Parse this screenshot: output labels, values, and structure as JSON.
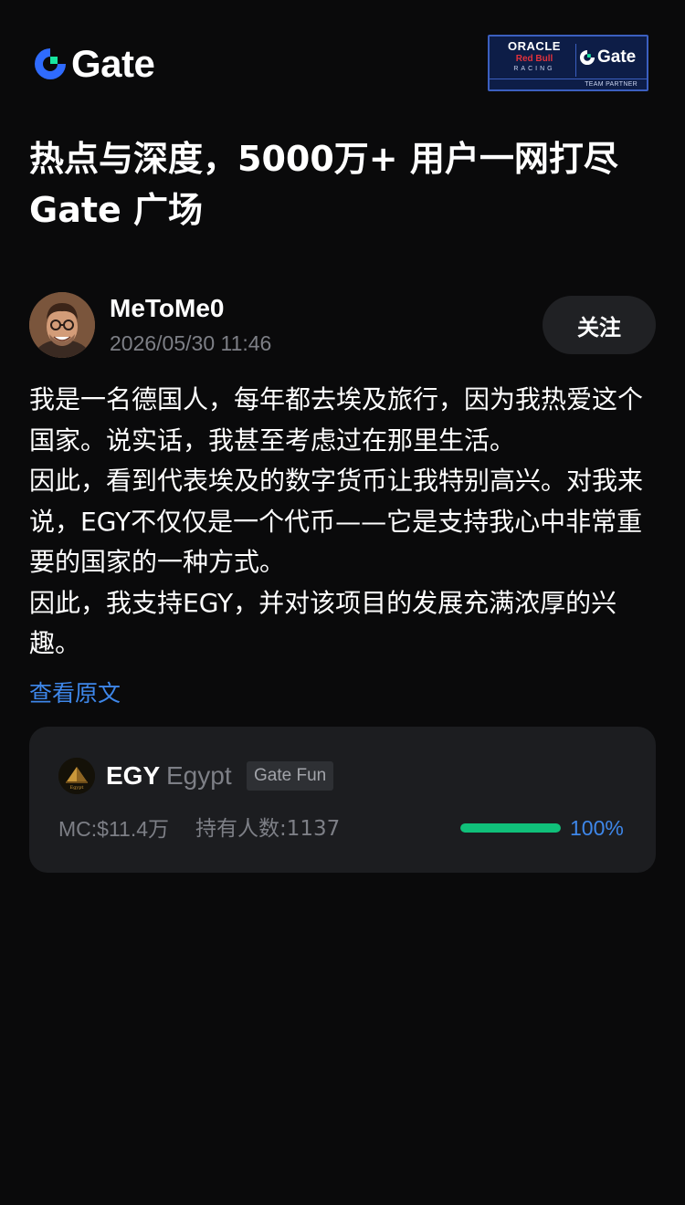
{
  "header": {
    "logo_text": "Gate",
    "partner": {
      "oracle": "ORACLE",
      "redbull": "Red Bull",
      "racing": "RACING",
      "gate": "Gate",
      "footer": "TEAM PARTNER"
    }
  },
  "headline": {
    "line1": "热点与深度，5000万+ 用户一网打尽",
    "line2": "Gate 广场"
  },
  "post": {
    "author": "MeToMe0",
    "time": "2026/05/30 11:46",
    "follow_label": "关注",
    "paragraphs": [
      "我是一名德国人，每年都去埃及旅行，因为我热爱这个国家。说实话，我甚至考虑过在那里生活。",
      "因此，看到代表埃及的数字货币让我特别高兴。对我来说，EGY不仅仅是一个代币——它是支持我心中非常重要的国家的一种方式。",
      "因此，我支持EGY，并对该项目的发展充满浓厚的兴趣。"
    ],
    "view_original": "查看原文"
  },
  "token": {
    "symbol": "EGY",
    "name": "Egypt",
    "tag": "Gate Fun",
    "market_cap": "MC:$11.4万",
    "holders": "持有人数:1137",
    "progress": 1.0,
    "progress_label": "100%"
  },
  "colors": {
    "background": "#0a0a0b",
    "accent_blue": "#3e87ea",
    "progress_green": "#10c07a",
    "card_bg": "#1c1d20"
  }
}
